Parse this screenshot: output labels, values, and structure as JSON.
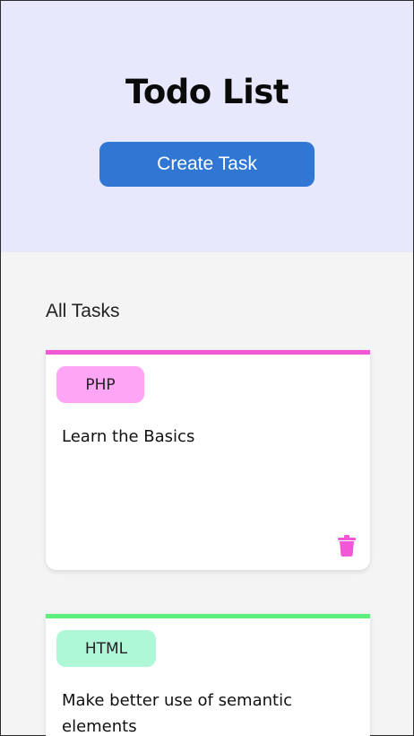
{
  "header": {
    "title": "Todo List",
    "create_button_label": "Create Task"
  },
  "main": {
    "section_label": "All Tasks",
    "tasks": [
      {
        "tag": "PHP",
        "tag_color": "#fca6f5",
        "accent_color": "#f257d6",
        "text": "Learn the Basics",
        "delete_icon": "trash-icon"
      },
      {
        "tag": "HTML",
        "tag_color": "#aef8d8",
        "accent_color": "#5ef07e",
        "text": "Make better use of semantic elements"
      }
    ]
  },
  "colors": {
    "header_bg": "#e8e8fc",
    "button_bg": "#3077d4",
    "page_bg": "#f4f4f4",
    "trash_icon": "#f257d6"
  }
}
